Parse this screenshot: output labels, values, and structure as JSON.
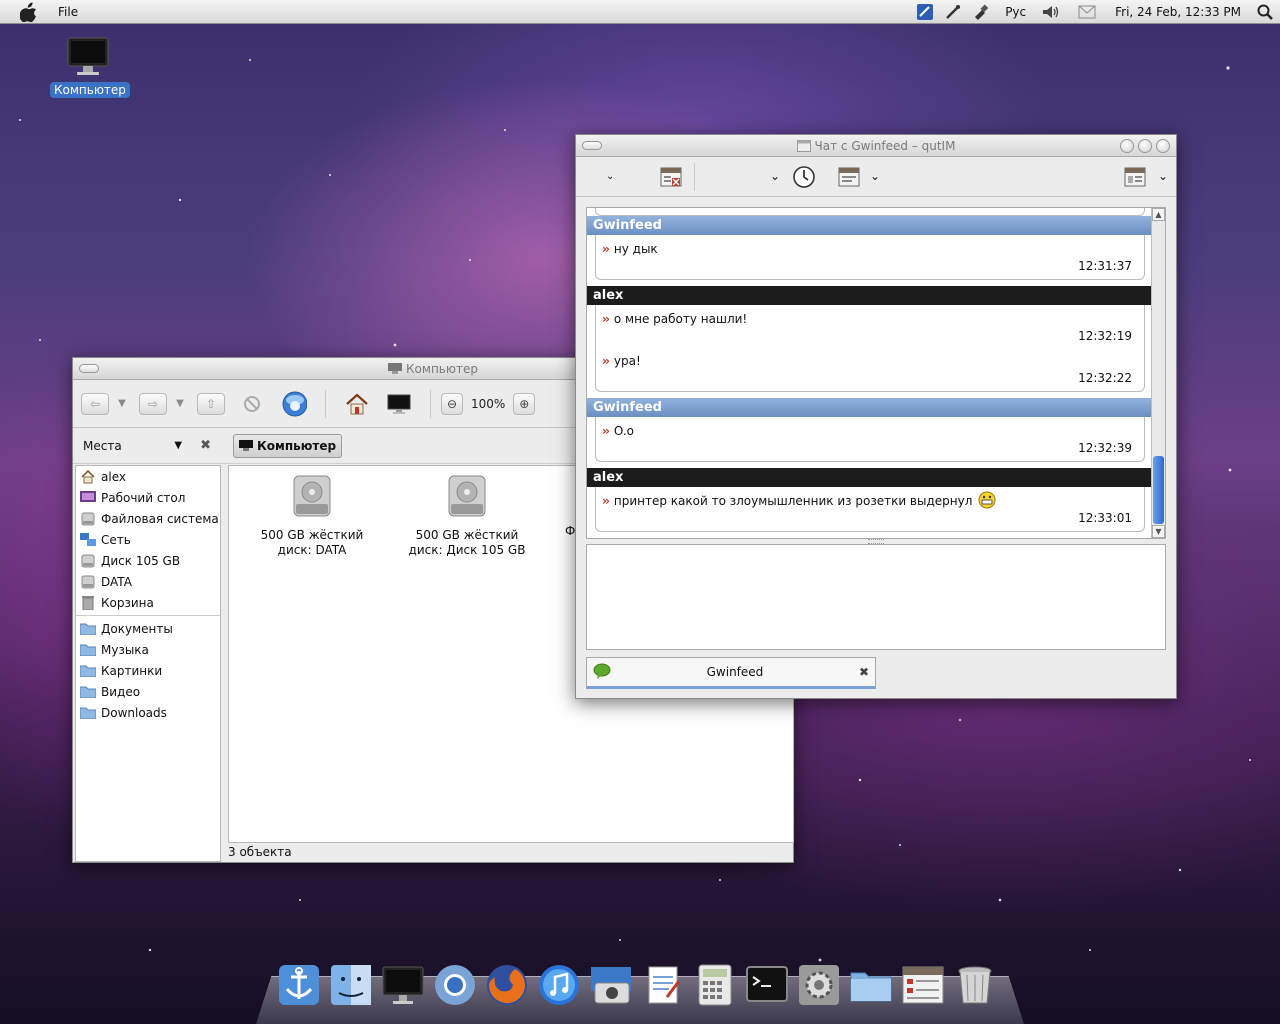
{
  "menubar": {
    "file_label": "File",
    "input_language": "Рус",
    "clock": "Fri, 24 Feb, 12:33 PM"
  },
  "desktop": {
    "computer_icon_label": "Компьютер"
  },
  "file_manager": {
    "title": "Компьютер",
    "zoom": "100%",
    "places_label": "Места",
    "path_button": "Компьютер",
    "sidebar_items": [
      {
        "label": "alex",
        "icon": "home-icon"
      },
      {
        "label": "Рабочий стол",
        "icon": "desktop-icon"
      },
      {
        "label": "Файловая система",
        "icon": "drive-icon"
      },
      {
        "label": "Сеть",
        "icon": "network-icon"
      },
      {
        "label": "Диск 105 GB",
        "icon": "drive-icon"
      },
      {
        "label": "DATA",
        "icon": "drive-icon"
      },
      {
        "label": "Корзина",
        "icon": "trash-icon"
      }
    ],
    "bookmarks": [
      {
        "label": "Документы",
        "icon": "folder-icon"
      },
      {
        "label": "Музыка",
        "icon": "folder-icon"
      },
      {
        "label": "Картинки",
        "icon": "folder-icon"
      },
      {
        "label": "Видео",
        "icon": "folder-icon"
      },
      {
        "label": "Downloads",
        "icon": "folder-icon"
      }
    ],
    "drives": [
      {
        "line1": "500 GB жёсткий",
        "line2": "диск: DATA"
      },
      {
        "line1": "500 GB жёсткий",
        "line2": "диск: Диск 105 GB"
      },
      {
        "line1": "Ф",
        "line2": ""
      }
    ],
    "status": "3 объекта"
  },
  "chat": {
    "title": "Чат с Gwinfeed – qutIM",
    "tab_name": "Gwinfeed",
    "messages": [
      {
        "sender": "Gwinfeed",
        "self": false,
        "lines": [
          {
            "text": "ну дык",
            "time": "12:31:37"
          }
        ]
      },
      {
        "sender": "alex",
        "self": true,
        "lines": [
          {
            "text": "о мне работу нашли!",
            "time": "12:32:19"
          },
          {
            "text": "ура!",
            "time": "12:32:22"
          }
        ]
      },
      {
        "sender": "Gwinfeed",
        "self": false,
        "lines": [
          {
            "text": "O.o",
            "time": "12:32:39"
          }
        ]
      },
      {
        "sender": "alex",
        "self": true,
        "lines": [
          {
            "text": "принтер какой то злоумышленник из розетки выдернул",
            "time": "12:33:01",
            "emoticon": true
          }
        ]
      }
    ]
  },
  "dock": {
    "items": [
      "anchor-icon",
      "finder-icon",
      "monitor-icon",
      "chrome-icon",
      "firefox-icon",
      "itunes-icon",
      "photo-icon",
      "text-editor-icon",
      "calculator-icon",
      "terminal-icon",
      "settings-icon",
      "folder-icon",
      "file-manager-icon",
      "trash-icon"
    ]
  }
}
